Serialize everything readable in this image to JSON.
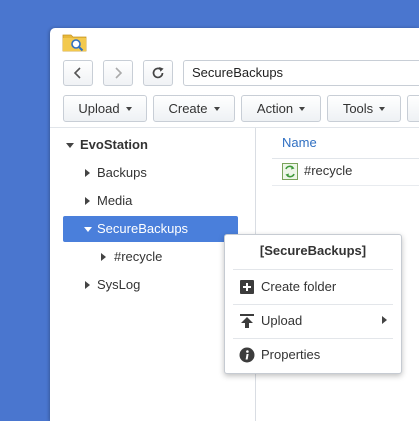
{
  "nav": {
    "back_icon": "chevron-left-icon",
    "forward_icon": "chevron-right-icon",
    "refresh_icon": "refresh-icon",
    "path": "SecureBackups"
  },
  "toolbar": {
    "upload": "Upload",
    "create": "Create",
    "action": "Action",
    "tools": "Tools"
  },
  "tree": {
    "root": "EvoStation",
    "items": [
      {
        "label": "Backups"
      },
      {
        "label": "Media"
      },
      {
        "label": "SecureBackups"
      },
      {
        "label": "#recycle"
      },
      {
        "label": "SysLog"
      }
    ]
  },
  "filelist": {
    "column_name": "Name",
    "rows": [
      {
        "name": "#recycle"
      }
    ]
  },
  "context_menu": {
    "title": "[SecureBackups]",
    "items": [
      {
        "label": "Create folder",
        "icon": "add-folder-icon"
      },
      {
        "label": "Upload",
        "icon": "upload-icon"
      },
      {
        "label": "Properties",
        "icon": "info-icon"
      }
    ]
  },
  "colors": {
    "desktop": "#4a76cf",
    "selection": "#4a7fdb",
    "link": "#2f6fc2"
  }
}
